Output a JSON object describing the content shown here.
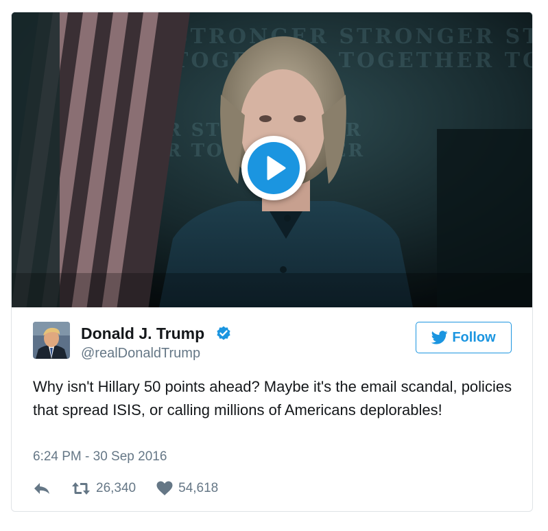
{
  "author": {
    "name": "Donald J. Trump",
    "handle": "@realDonaldTrump",
    "verified": true
  },
  "follow_label": "Follow",
  "tweet": {
    "text": "Why isn't Hillary 50 points ahead? Maybe it's the email scandal, policies that spread ISIS, or calling millions of Americans deplorables!",
    "timestamp": "6:24 PM - 30 Sep 2016"
  },
  "stats": {
    "retweets": "26,340",
    "likes": "54,618"
  },
  "media": {
    "type": "video",
    "icon": "play-icon"
  },
  "colors": {
    "accent": "#1b95e0",
    "text": "#14171a",
    "muted": "#657786",
    "border": "#dfe3e6"
  }
}
